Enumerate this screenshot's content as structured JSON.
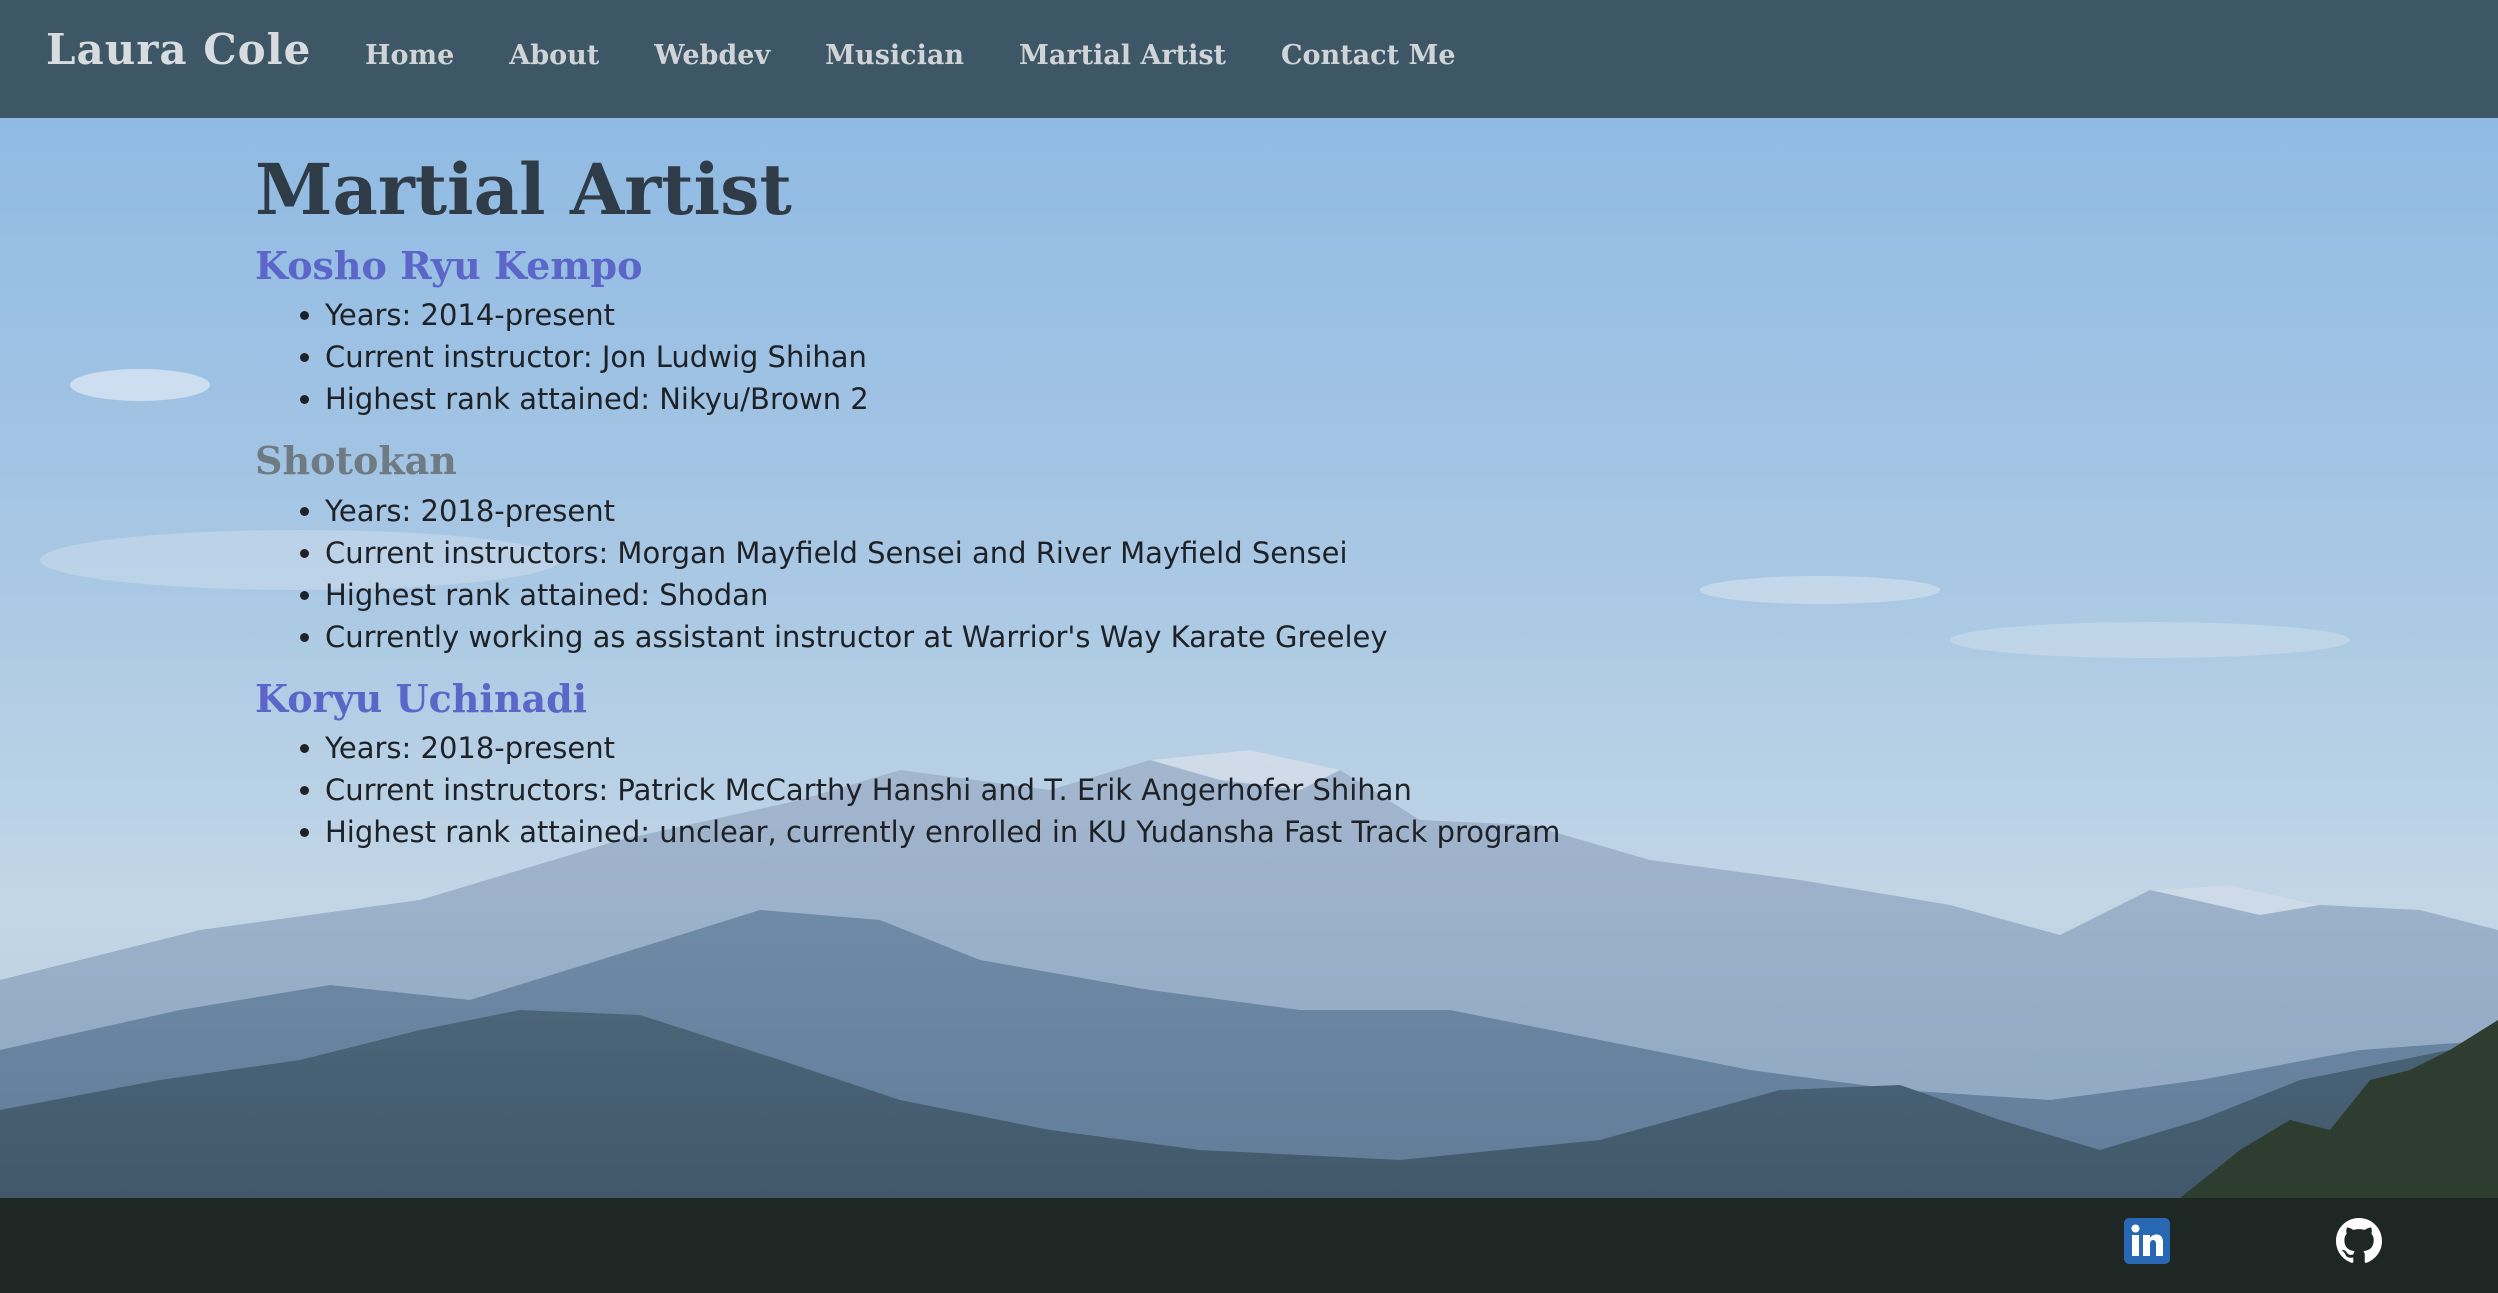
{
  "navbar": {
    "brand": "Laura Cole",
    "links": [
      {
        "label": "Home"
      },
      {
        "label": "About"
      },
      {
        "label": "Webdev"
      },
      {
        "label": "Musician"
      },
      {
        "label": "Martial Artist"
      },
      {
        "label": "Contact Me"
      }
    ]
  },
  "main": {
    "title": "Martial Artist",
    "sections": [
      {
        "heading": "Kosho Ryu Kempo",
        "items": [
          "Years: 2014-present",
          "Current instructor: Jon Ludwig Shihan",
          "Highest rank attained: Nikyu/Brown 2"
        ]
      },
      {
        "heading": "Shotokan",
        "items": [
          "Years: 2018-present",
          "Current instructors: Morgan Mayfield Sensei and River Mayfield Sensei",
          "Highest rank attained: Shodan",
          "Currently working as assistant instructor at Warrior's Way Karate Greeley"
        ]
      },
      {
        "heading": "Koryu Uchinadi",
        "items": [
          "Years: 2018-present",
          "Current instructors: Patrick McCarthy Hanshi and T. Erik Angerhofer Shihan",
          "Highest rank attained: unclear, currently enrolled in KU Yudansha Fast Track program"
        ]
      }
    ]
  },
  "footer": {
    "icons": [
      "linkedin-icon",
      "github-icon"
    ]
  },
  "colors": {
    "navbar": "#3d5766",
    "heading_blue": "#5b66c8",
    "heading_grey": "#6f7a82",
    "linkedin": "#2867b2"
  }
}
